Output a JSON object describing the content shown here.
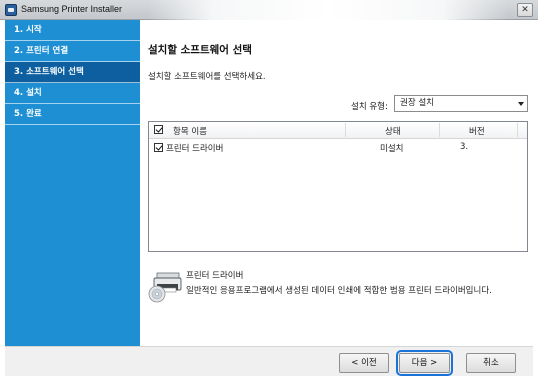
{
  "window": {
    "title": "Samsung Printer Installer",
    "close_glyph": "✕"
  },
  "sidebar": {
    "steps": [
      {
        "label": "1. 시작"
      },
      {
        "label": "2. 프린터 연결"
      },
      {
        "label": "3. 소프트웨어 선택",
        "active": true
      },
      {
        "label": "4. 설치"
      },
      {
        "label": "5. 완료"
      }
    ]
  },
  "main": {
    "title": "설치할 소프트웨어 선택",
    "subtitle": "설치할 소프트웨어를 선택하세요.",
    "install_type": {
      "label": "설치 유형:",
      "selected": "권장 설치"
    },
    "table": {
      "headers": [
        "항목 이름",
        "상태",
        "버전"
      ],
      "rows": [
        {
          "name": "프린터 드라이버",
          "status": "미설치",
          "version": "3.",
          "checked": true
        }
      ]
    },
    "description": {
      "title": "프린터 드라이버",
      "text": "일반적인 응용프로그램에서 생성된 데이터 인쇄에 적합한 범용 프린터 드라이버입니다.",
      "icon": "printer-cd-icon"
    }
  },
  "footer": {
    "back_label": "< 이전",
    "next_label": "다음 >",
    "cancel_label": "취소"
  },
  "colors": {
    "sidebar": "#1e8fd2",
    "sidebar_active": "#0d5f9f",
    "focus": "#1a73d9"
  }
}
